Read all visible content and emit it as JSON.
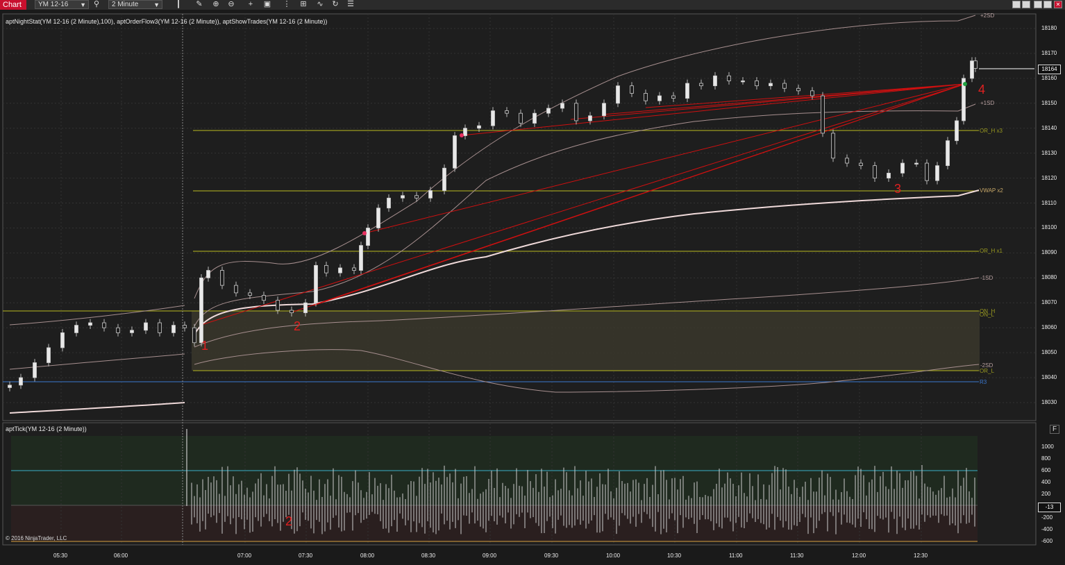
{
  "toolbar": {
    "tab_label": "Chart",
    "instrument": "YM 12-16",
    "interval": "2 Minute"
  },
  "price_panel": {
    "indicators_label": "aptNightStat(YM 12-16 (2 Minute),100), aptOrderFlow3(YM 12-16 (2 Minute)), aptShowTrades(YM 12-16 (2 Minute))",
    "current_price": "18164",
    "y_ticks": [
      "18180",
      "18170",
      "18160",
      "18150",
      "18140",
      "18130",
      "18120",
      "18110",
      "18100",
      "18090",
      "18080",
      "18070",
      "18060",
      "18050",
      "18040",
      "18030"
    ],
    "level_labels": {
      "sd2_upper": "+2SD",
      "sd1_upper": "+1SD",
      "orh_x3": "OR_H  x3",
      "vwap_x2": "VWAP  x2",
      "orh_x1": "OR_H  x1",
      "sd1_lower": "-1SD",
      "on_h": "ON_H",
      "on_l": "ON_L",
      "sd2_lower": "-2SD",
      "or_l": "OR_L",
      "r3": "R3"
    },
    "annotations": [
      "1",
      "2",
      "3",
      "4"
    ]
  },
  "tick_panel": {
    "indicator_label": "aptTick(YM 12-16 (2 Minute))",
    "current_value": "-13",
    "y_ticks": [
      "1000",
      "800",
      "600",
      "400",
      "200",
      "0",
      "-200",
      "-400",
      "-600"
    ],
    "annotation": "2",
    "f_button": "F"
  },
  "x_axis": {
    "ticks": [
      "05:30",
      "06:00",
      "07:00",
      "07:30",
      "08:00",
      "08:30",
      "09:00",
      "09:30",
      "10:00",
      "10:30",
      "11:00",
      "11:30",
      "12:00",
      "12:30"
    ]
  },
  "copyright": "© 2016 NinjaTrader, LLC",
  "colors": {
    "chart_tab": "#c8102e",
    "background": "#1a1a1a",
    "level_yellow": "#9a9a20",
    "vwap": "#f0dada",
    "band": "#a89090",
    "trend_lines": "#d01010",
    "r3": "#3a78d0",
    "annotations": "#e02020"
  }
}
